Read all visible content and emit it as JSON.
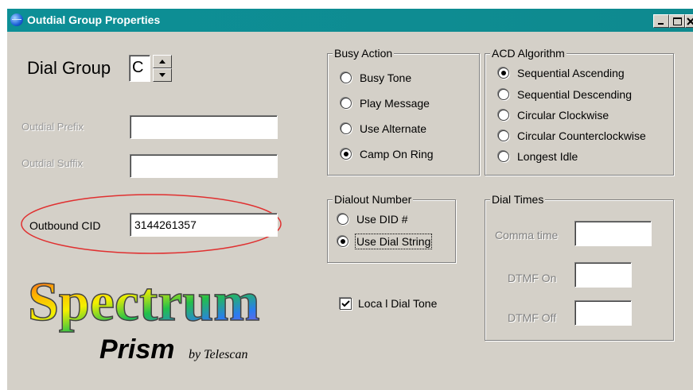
{
  "window": {
    "title": "Outdial Group Properties",
    "controls": {
      "minimize": "_",
      "maximize": "□",
      "close": "×"
    }
  },
  "dial_group": {
    "label": "Dial Group",
    "value": "C"
  },
  "outdial_prefix": {
    "label": "Outdial Prefix",
    "value": ""
  },
  "outdial_suffix": {
    "label": "Outdial Suffix",
    "value": ""
  },
  "outbound_cid": {
    "label": "Outbound CID",
    "value": "3144261357"
  },
  "logo": {
    "main": "Spectrum",
    "sub": "Prism",
    "by": "by Telescan"
  },
  "busy_action": {
    "legend": "Busy Action",
    "options": [
      "Busy Tone",
      "Play Message",
      "Use Alternate",
      "Camp On Ring"
    ],
    "selected_index": 3
  },
  "acd_algorithm": {
    "legend": "ACD Algorithm",
    "options": [
      "Sequential Ascending",
      "Sequential Descending",
      "Circular Clockwise",
      "Circular Counterclockwise",
      "Longest Idle"
    ],
    "selected_index": 0
  },
  "dialout_number": {
    "legend": "Dialout Number",
    "options": [
      "Use DID #",
      "Use Dial String"
    ],
    "selected_index": 1
  },
  "dial_times": {
    "legend": "Dial Times",
    "comma_time": {
      "label": "Comma time",
      "value": ""
    },
    "dtmf_on": {
      "label": "DTMF On",
      "value": ""
    },
    "dtmf_off": {
      "label": "DTMF Off",
      "value": ""
    }
  },
  "local_dial_tone": {
    "label": "Loca l Dial Tone",
    "checked": true
  },
  "colors": {
    "titlebar": "#0d8f96",
    "face": "#d4d0c8",
    "annotation": "#e03030"
  }
}
